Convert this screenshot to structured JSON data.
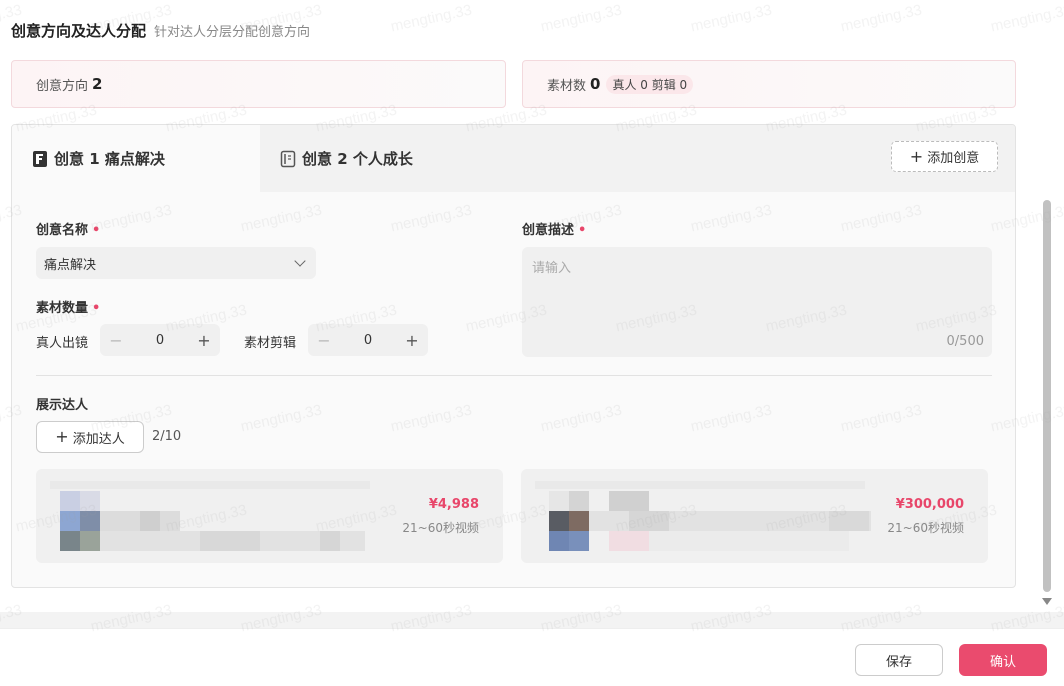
{
  "header": {
    "title": "创意方向及达人分配",
    "subtitle": "针对达人分层分配创意方向"
  },
  "stats": {
    "direction_label": "创意方向",
    "direction_count": "2",
    "material_label": "素材数",
    "material_count": "0",
    "real_tag": "真人 0",
    "edit_tag": "剪辑 0"
  },
  "tabs": [
    {
      "label": "创意 1 痛点解决",
      "active": true,
      "icon": "doc-filled-icon"
    },
    {
      "label": "创意 2 个人成长",
      "active": false,
      "icon": "doc-outline-icon"
    }
  ],
  "add_idea_label": "添加创意",
  "form": {
    "name_label": "创意名称",
    "name_value": "痛点解决",
    "desc_label": "创意描述",
    "desc_placeholder": "请输入",
    "desc_counter": "0/500",
    "quantity_label": "素材数量",
    "real_label": "真人出镜",
    "real_value": "0",
    "edit_label": "素材剪辑",
    "edit_value": "0",
    "required_mark": "•"
  },
  "talents": {
    "label": "展示达人",
    "add_label": "添加达人",
    "count": "2/10",
    "cards": [
      {
        "price": "¥4,988",
        "duration": "21~60秒视频"
      },
      {
        "price": "¥300,000",
        "duration": "21~60秒视频"
      }
    ]
  },
  "footer": {
    "save_label": "保存",
    "confirm_label": "确认"
  },
  "watermark": "mengting.33",
  "colors": {
    "accent": "#ea4b6e",
    "price": "#e8466a"
  }
}
